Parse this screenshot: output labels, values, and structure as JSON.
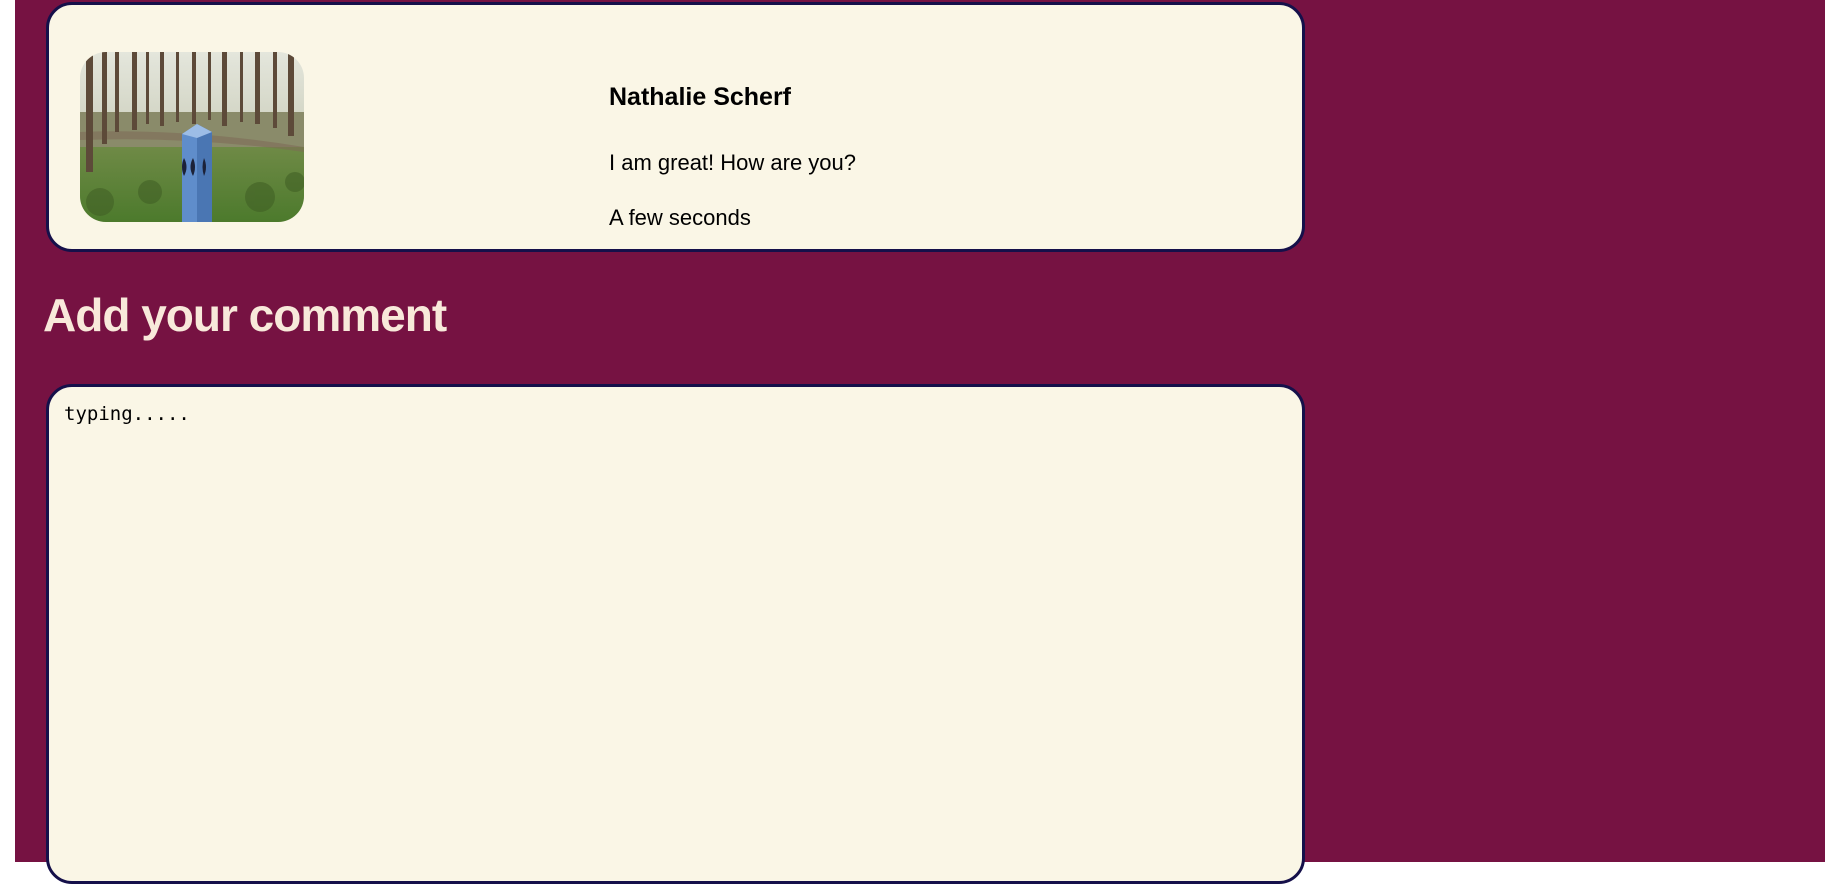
{
  "colors": {
    "page_background": "#761242",
    "card_background": "#faf6e6",
    "card_border": "#15104a",
    "heading_color": "#f8e9da"
  },
  "comment": {
    "avatar_icon": "forest-marker-photo",
    "author": "Nathalie Scherf",
    "text": "I am great! How are you?",
    "time": "A few seconds"
  },
  "add_comment": {
    "heading": "Add your comment",
    "input_value": "typing....."
  }
}
